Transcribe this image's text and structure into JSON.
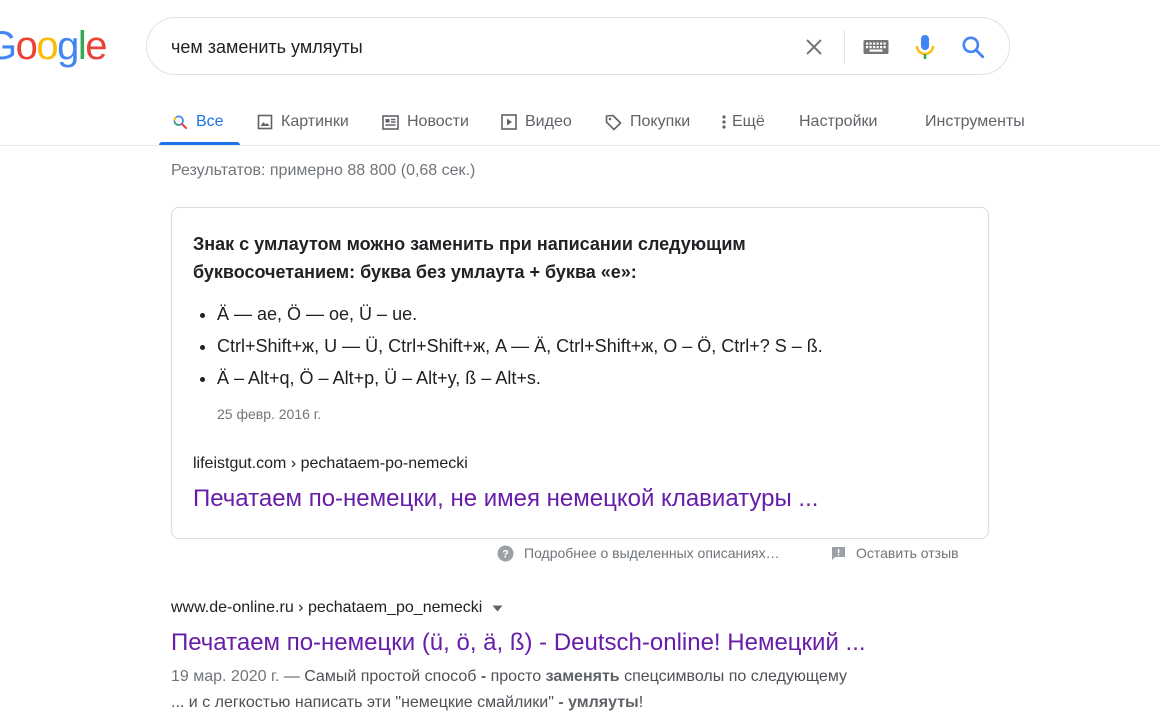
{
  "logo": {
    "letters": [
      "o",
      "o",
      "g",
      "l",
      "e"
    ],
    "prefix": "G",
    "colors": {
      "blue": "#4285f4",
      "red": "#ea4335",
      "yellow": "#fbbc05",
      "green": "#34a853"
    }
  },
  "search": {
    "query": "чем заменить умляуты",
    "icons": [
      "clear-icon",
      "keyboard-icon",
      "microphone-icon",
      "search-icon"
    ]
  },
  "tabs": [
    {
      "label": "Все",
      "icon": "search-icon",
      "active": true
    },
    {
      "label": "Картинки",
      "icon": "image-icon"
    },
    {
      "label": "Новости",
      "icon": "news-icon"
    },
    {
      "label": "Видео",
      "icon": "play-icon"
    },
    {
      "label": "Покупки",
      "icon": "tag-icon"
    },
    {
      "label": "Ещё",
      "icon": "more-vert-icon"
    },
    {
      "label": "Настройки"
    },
    {
      "label": "Инструменты"
    }
  ],
  "stats": "Результатов: примерно 88 800 (0,68 сек.) ",
  "featured_snippet": {
    "heading": "Знак с умлаутом можно заменить при написании следующим буквосочетанием: буква без умлаута + буква «е»:",
    "items": [
      "Ä — ae, Ö — oe, Ü – ue.",
      "Ctrl+Shift+ж, U — Ü, Ctrl+Shift+ж, A — Ä, Ctrl+Shift+ж, O – Ö, Ctrl+? S – ß.",
      "Ä – Alt+q, Ö – Alt+p, Ü – Alt+y, ß – Alt+s."
    ],
    "date": "25 февр. 2016 г.",
    "url": "lifeistgut.com › pechataem-po-nemecki",
    "link": "Печатаем по-немецки, не имея немецкой клавиатуры ..."
  },
  "feedback": {
    "about": "Подробнее о выделенных описаниях…",
    "send": "Оставить отзыв"
  },
  "result2": {
    "url": "www.de-online.ru › pechataem_po_nemecki",
    "title": "Печатаем по-немецки (ü, ö, ä, ß) - Deutsch-online! Немецкий ...",
    "date": "19 мар. 2020 г.",
    "dash": " — ",
    "desc1a": "Самый простой способ ",
    "desc1b": "-",
    "desc1c": " просто ",
    "desc1d": "заменять",
    "desc1e": " спецсимволы по следующему",
    "desc2a": "... и с легкостью написать эти \"немецкие смайлики\" ",
    "desc2b": "- умляуты",
    "desc2c": "!"
  },
  "colors": {
    "accent": "#1a73e8",
    "visited_link": "#681da8",
    "muted": "#70757a"
  }
}
